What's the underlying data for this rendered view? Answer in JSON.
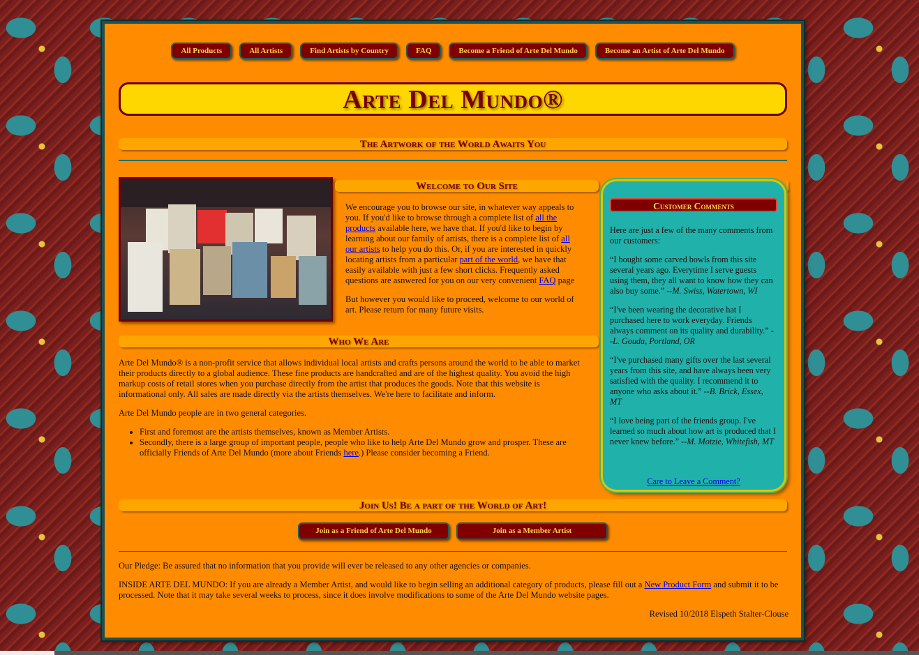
{
  "nav": {
    "items": [
      {
        "label": "All Products"
      },
      {
        "label": "All Artists"
      },
      {
        "label": "Find Artists by Country"
      },
      {
        "label": "FAQ"
      },
      {
        "label": "Become a Friend of Arte Del Mundo"
      },
      {
        "label": "Become an Artist of Arte Del Mundo"
      }
    ]
  },
  "header": {
    "title": "Arte Del Mundo®",
    "tagline": "The Artwork of the World Awaits You"
  },
  "welcome": {
    "heading": "Welcome to Our Site",
    "p1_a": "We encourage you to browse our site, in whatever way appeals to you. If you'd like to browse through a complete list of ",
    "p1_link1": "all the products",
    "p1_b": " available here, we have that. If you'd like to begin by learning about our family of artists, there is a complete list of ",
    "p1_link2": "all our artists",
    "p1_c": " to help you do this. Or, if you are interested in quickly locating artists from a particular ",
    "p1_link3": "part of the world",
    "p1_d": ", we have that easily available with just a few short clicks. Frequently asked questions are asnwered for you on our very convenient ",
    "p1_link4": "FAQ",
    "p1_e": " page",
    "p2": "But however you would like to proceed, welcome to our world of art. Please return for many future visits."
  },
  "who": {
    "heading": "Who We Are",
    "p1": "Arte Del Mundo® is a non-profit service that allows individual local artists and crafts persons around the world to be able to market their products directly to a global audience. These fine products are handcrafted and are of the highest quality. You avoid the high markup costs of retail stores when you purchase directly from the artist that produces the goods. Note that this website is informational only. All sales are made directly via the artists themselves. We're here to facilitate and inform.",
    "p2": "Arte Del Mundo people are in two general categories.",
    "li1": "First and foremost are the artists themselves, known as Member Artists.",
    "li2_a": "Secondly, there is a large group of important people, people who like to help Arte Del Mundo grow and prosper. These are officially Friends of Arte Del Mundo (more about Friends ",
    "li2_link": "here",
    "li2_b": ".) Please consider becoming a Friend."
  },
  "comments": {
    "title": "Customer Comments",
    "intro": "Here are just a few of the many comments from our customers:",
    "items": [
      {
        "quote": "“I bought some carved bowls from this site several years ago. Everytime I serve guests using them, they all want to know how they can also buy some.” --",
        "author": "M. Swiss, Watertown, WI"
      },
      {
        "quote": "“I've been wearing the decorative hat I purchased here to work everyday. Friends always comment on its quality and durability.” --",
        "author": "L. Gouda, Portland, OR"
      },
      {
        "quote": "“I've purchased many gifts over the last several years from this site, and have always been very satisfied with the quality. I recommend it to anyone who asks about it.” --",
        "author": "B. Brick, Essex, MT"
      },
      {
        "quote": "“I love being part of the friends group. I've learned so much about how art is produced that I never knew before.” --",
        "author": "M. Motzie, Whitefish, MT"
      }
    ],
    "link": "Care to Leave a Comment?"
  },
  "join": {
    "heading": "Join Us! Be a part of the World of Art!",
    "friend_button": "Join as a Friend of Arte Del Mundo",
    "artist_button": "Join as a Member Artist"
  },
  "footer": {
    "pledge": "Our Pledge: Be assured that no information that you provide will ever be released to any other agencies or companies.",
    "inside_a": "INSIDE ARTE DEL MUNDO: If you are already a Member Artist, and would like to begin selling an additional category of products, please fill out a ",
    "inside_link": "New Product Form",
    "inside_b": " and submit it to be processed. Note that it may take several weeks to process, since it does involve modifications to some of the Arte Del Mundo website pages.",
    "revised": "Revised 10/2018 Elspeth Stalter-Clouse"
  },
  "colors": {
    "page_bg": "#ff8c00",
    "button_bg": "#800000",
    "button_text": "#ffd24a",
    "banner_bg": "#ffd700",
    "comments_bg": "#20b2aa"
  }
}
